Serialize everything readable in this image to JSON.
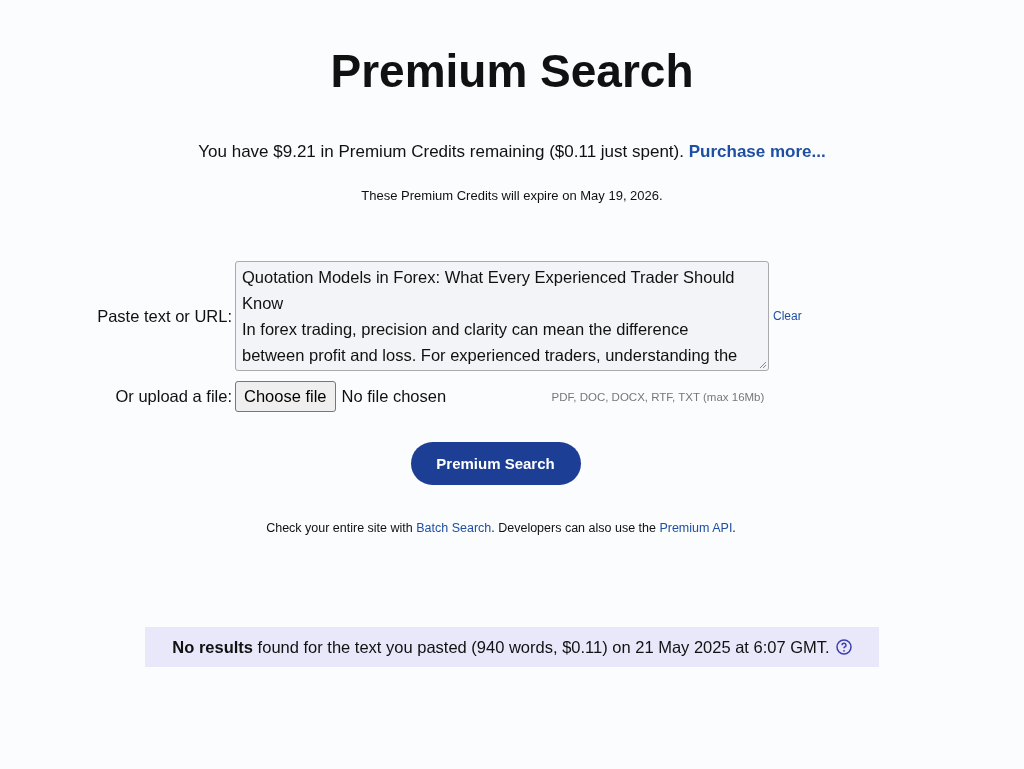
{
  "title": "Premium Search",
  "credits": {
    "text": "You have $9.21 in Premium Credits remaining ($0.11 just spent).",
    "link": "Purchase more..."
  },
  "expiry": "These Premium Credits will expire on May 19, 2026.",
  "paste": {
    "label": "Paste text or URL:",
    "lines": [
      "Quotation Models in Forex: What Every Experienced Trader Should",
      "Know",
      "In forex trading, precision and clarity can mean the difference",
      "between profit and loss. For experienced traders, understanding the"
    ],
    "clear": "Clear"
  },
  "upload": {
    "label": "Or upload a file:",
    "button": "Choose file",
    "status": "No file chosen",
    "hint": "PDF, DOC, DOCX, RTF, TXT (max 16Mb)"
  },
  "search_button": "Premium Search",
  "note": [
    {
      "kind": "text",
      "text": "Check your entire site with "
    },
    {
      "kind": "link",
      "text": "Batch Search"
    },
    {
      "kind": "text",
      "text": ". Developers can also use the "
    },
    {
      "kind": "link",
      "text": "Premium API"
    },
    {
      "kind": "text",
      "text": "."
    }
  ],
  "result": "**No results** found for the text you pasted (940 words, $0.11) on 21 May 2025 at 6:07 GMT."
}
